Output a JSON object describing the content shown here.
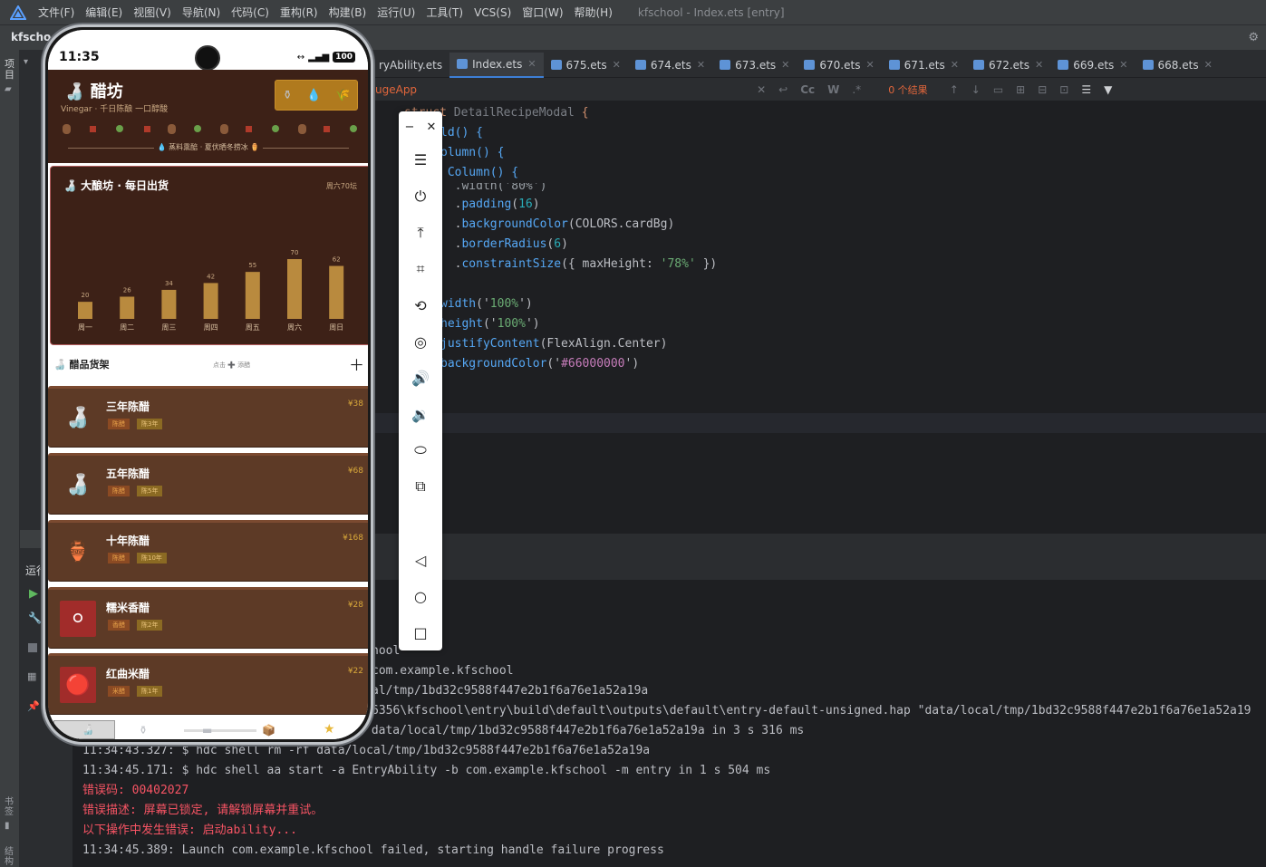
{
  "menu": {
    "items": [
      "文件(F)",
      "编辑(E)",
      "视图(V)",
      "导航(N)",
      "代码(C)",
      "重构(R)",
      "构建(B)",
      "运行(U)",
      "工具(T)",
      "VCS(S)",
      "窗口(W)",
      "帮助(H)"
    ],
    "window_title": "kfschool - Index.ets [entry]"
  },
  "project": {
    "name": "kfscho"
  },
  "side": {
    "project_label": "项目",
    "run_label": "运行",
    "bookmark_label": "书签",
    "structure_label": "结构"
  },
  "tabs": [
    {
      "label": "ryAbility.ets",
      "active": false
    },
    {
      "label": "Index.ets",
      "active": true
    },
    {
      "label": "675.ets",
      "active": false
    },
    {
      "label": "674.ets",
      "active": false
    },
    {
      "label": "673.ets",
      "active": false
    },
    {
      "label": "670.ets",
      "active": false
    },
    {
      "label": "671.ets",
      "active": false
    },
    {
      "label": "672.ets",
      "active": false
    },
    {
      "label": "669.ets",
      "active": false
    },
    {
      "label": "668.ets",
      "active": false
    }
  ],
  "find": {
    "query": "ugeApp",
    "result": "0 个结果",
    "cc": "Cc",
    "w": "W",
    "regex": ".*"
  },
  "code": {
    "l1a": "struct",
    "l1b": " DetailRecipeModal ",
    "l1c": "{",
    "l2a": "ld() {",
    "l3a": "olumn() {",
    "l4a": " Column() {",
    "l5a": "  .width('80%')",
    "l6a": "  .",
    "l6b": "padding",
    "l6c": "(",
    "l6d": "16",
    "l6e": ")",
    "l7a": "  .",
    "l7b": "backgroundColor",
    "l7c": "(COLORS.cardBg)",
    "l8a": "  .",
    "l8b": "borderRadius",
    "l8c": "(",
    "l8d": "6",
    "l8e": ")",
    "l9a": "  .",
    "l9b": "constraintSize",
    "l9c": "({ maxHeight: ",
    "l9d": "'78%'",
    "l9e": " })",
    "l10a": "width",
    "l10b": "('",
    "l10c": "100%",
    "l10d": "')",
    "l11a": "height",
    "l11b": "('",
    "l11c": "100%",
    "l11d": "')",
    "l12a": "justifyContent",
    "l12b": "(FlexAlign.Center)",
    "l13a": "backgroundColor",
    "l13b": "('",
    "l13c": "#66000000",
    "l13d": "')"
  },
  "console": {
    "lines": [
      {
        "text": "hool",
        "err": false
      },
      {
        "text": "com.example.kfschool",
        "err": false
      },
      {
        "text": "al/tmp/1bd32c9588f447e2b1f6a76e1a52a19a",
        "err": false
      },
      {
        "text": "6356\\kfschool\\entry\\build\\default\\outputs\\default\\entry-default-unsigned.hap \"data/local/tmp/1bd32c9588f447e2b1f6a76e1a52a19",
        "err": false
      },
      {
        "text": " data/local/tmp/1bd32c9588f447e2b1f6a76e1a52a19a in 3 s 316 ms",
        "err": false
      },
      {
        "text": "11:34:43.327: $ hdc shell rm -rf data/local/tmp/1bd32c9588f447e2b1f6a76e1a52a19a",
        "err": false
      },
      {
        "text": "11:34:45.171: $ hdc shell aa start -a EntryAbility -b com.example.kfschool -m entry in 1 s 504 ms",
        "err": false
      },
      {
        "text": "错误码: 00402027",
        "err": true
      },
      {
        "text": "错误描述: 屏幕已锁定, 请解锁屏幕并重试。",
        "err": true
      },
      {
        "text": "以下操作中发生错误: 启动ability...",
        "err": true
      },
      {
        "text": "11:34:45.389: Launch com.example.kfschool failed, starting handle failure progress",
        "err": false
      }
    ]
  },
  "phone": {
    "time": "11:35",
    "battery": "100",
    "app_title": "醋坊",
    "app_subtitle": "Vinegar · 千日陈酿 一口醇酸",
    "divider_text": "💧 蒸料熏醅 · 夏伏晒冬捞冰 ⚱️",
    "chart_card_title": "大酿坊 · 每日出货",
    "chart_card_tag": "周六70坛",
    "shelf_title": "醋品货架",
    "shelf_hint": "点击 ➕ 添醋",
    "items": [
      {
        "name": "三年陈醋",
        "price": "¥38",
        "badge1": "陈醋",
        "badge2": "陈3年",
        "icon": "🍶",
        "red": false
      },
      {
        "name": "五年陈醋",
        "price": "¥68",
        "badge1": "陈醋",
        "badge2": "陈5年",
        "icon": "🍶",
        "red": false
      },
      {
        "name": "十年陈醋",
        "price": "¥168",
        "badge1": "陈醋",
        "badge2": "陈10年",
        "icon": "🏺",
        "red": false
      },
      {
        "name": "糯米香醋",
        "price": "¥28",
        "badge1": "香醋",
        "badge2": "陈2年",
        "icon": "⚪",
        "red": true
      },
      {
        "name": "红曲米醋",
        "price": "¥22",
        "badge1": "米醋",
        "badge2": "陈1年",
        "icon": "🔴",
        "red": true
      }
    ]
  },
  "chart_data": {
    "type": "bar",
    "title": "大酿坊 · 每日出货",
    "categories": [
      "周一",
      "周二",
      "周三",
      "周四",
      "周五",
      "周六",
      "周日"
    ],
    "values": [
      20,
      26,
      34,
      42,
      55,
      70,
      62
    ],
    "ylim": [
      0,
      70
    ],
    "bar_color": "#b98a3e",
    "grid": false
  },
  "colors": {
    "accent": "#3d7fd6",
    "error": "#f75464",
    "card": "#5d3a26",
    "header": "#3d2117"
  }
}
